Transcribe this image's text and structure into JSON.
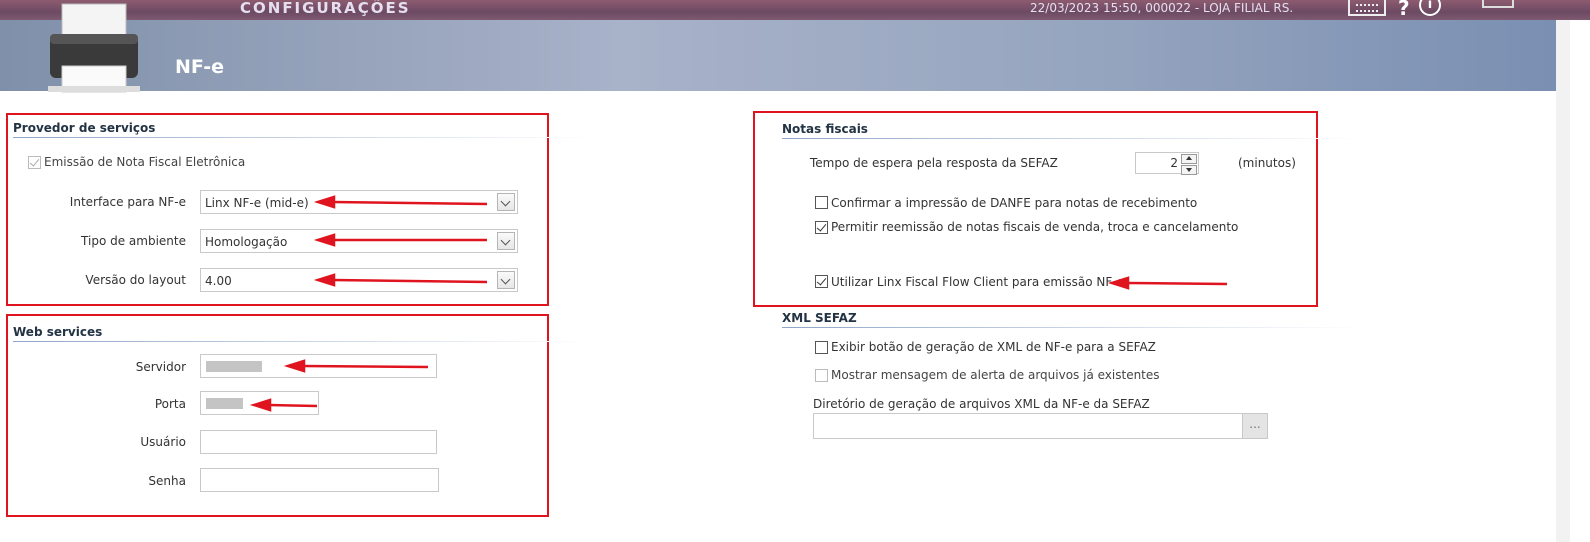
{
  "topbar": {
    "title": "CONFIGURAÇÕES",
    "status": "22/03/2023 15:50, 000022 - LOJA FILIAL RS."
  },
  "header": {
    "title": "NF-e"
  },
  "provedor": {
    "title": "Provedor de serviços",
    "emissao_label": "Emissão de Nota Fiscal Eletrônica",
    "emissao_checked": true,
    "interface_label": "Interface para NF-e",
    "interface_value": "Linx NF-e (mid-e)",
    "ambiente_label": "Tipo de ambiente",
    "ambiente_value": "Homologação",
    "versao_label": "Versão do layout",
    "versao_value": "4.00"
  },
  "webservices": {
    "title": "Web services",
    "servidor_label": "Servidor",
    "porta_label": "Porta",
    "usuario_label": "Usuário",
    "senha_label": "Senha"
  },
  "notas": {
    "title": "Notas fiscais",
    "tempo_label": "Tempo de espera pela resposta da SEFAZ",
    "tempo_value": "2",
    "tempo_unit": "(minutos)",
    "confirmar_label": "Confirmar a impressão de DANFE para notas de recebimento",
    "confirmar_checked": false,
    "permitir_label": "Permitir reemissão de notas fiscais de venda, troca e cancelamento",
    "permitir_checked": true,
    "utilizar_label": "Utilizar Linx Fiscal Flow Client para emissão NF-e",
    "utilizar_checked": true
  },
  "xml": {
    "title": "XML SEFAZ",
    "exibir_label": "Exibir botão de geração de XML de NF-e para a SEFAZ",
    "exibir_checked": false,
    "mostrar_label": "Mostrar mensagem de alerta de arquivos já existentes",
    "mostrar_checked": false,
    "diretorio_label": "Diretório de geração de arquivos XML da NF-e da SEFAZ",
    "browse_label": "..."
  },
  "colors": {
    "annotation": "#e0141e",
    "header": "#96a5bf"
  }
}
